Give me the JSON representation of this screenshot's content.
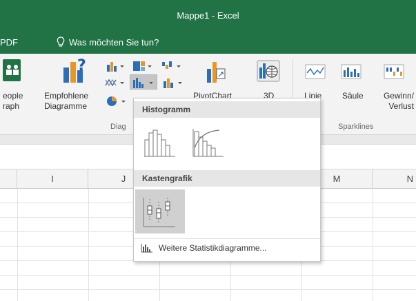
{
  "titlebar": {
    "title": "Mappe1 - Excel"
  },
  "tellbar": {
    "pdf_label": "PDF",
    "tell_label": "Was möchten Sie tun?"
  },
  "ribbon": {
    "people_graph": {
      "line1": "eople",
      "line2": "raph"
    },
    "recommended_charts": {
      "line1": "Empfohlene",
      "line2": "Diagramme"
    },
    "pivotchart_label": "PivotChart",
    "map_3d_label": "3D",
    "groups": {
      "charts": "Diag",
      "sparklines": "Sparklines"
    },
    "sparklines": {
      "line": "Linie",
      "column": "Säule",
      "winloss_line1": "Gewinn/",
      "winloss_line2": "Verlust"
    }
  },
  "columns": [
    "I",
    "J",
    "M",
    "N"
  ],
  "dropdown": {
    "section_histogram": "Histogramm",
    "section_boxplot": "Kastengrafik",
    "more_label": "Weitere Statistikdiagramme..."
  },
  "colors": {
    "excel_green": "#217346",
    "ribbon_bg": "#f3f3f3",
    "accent_blue": "#2b6fb8",
    "accent_orange": "#e5972a"
  }
}
